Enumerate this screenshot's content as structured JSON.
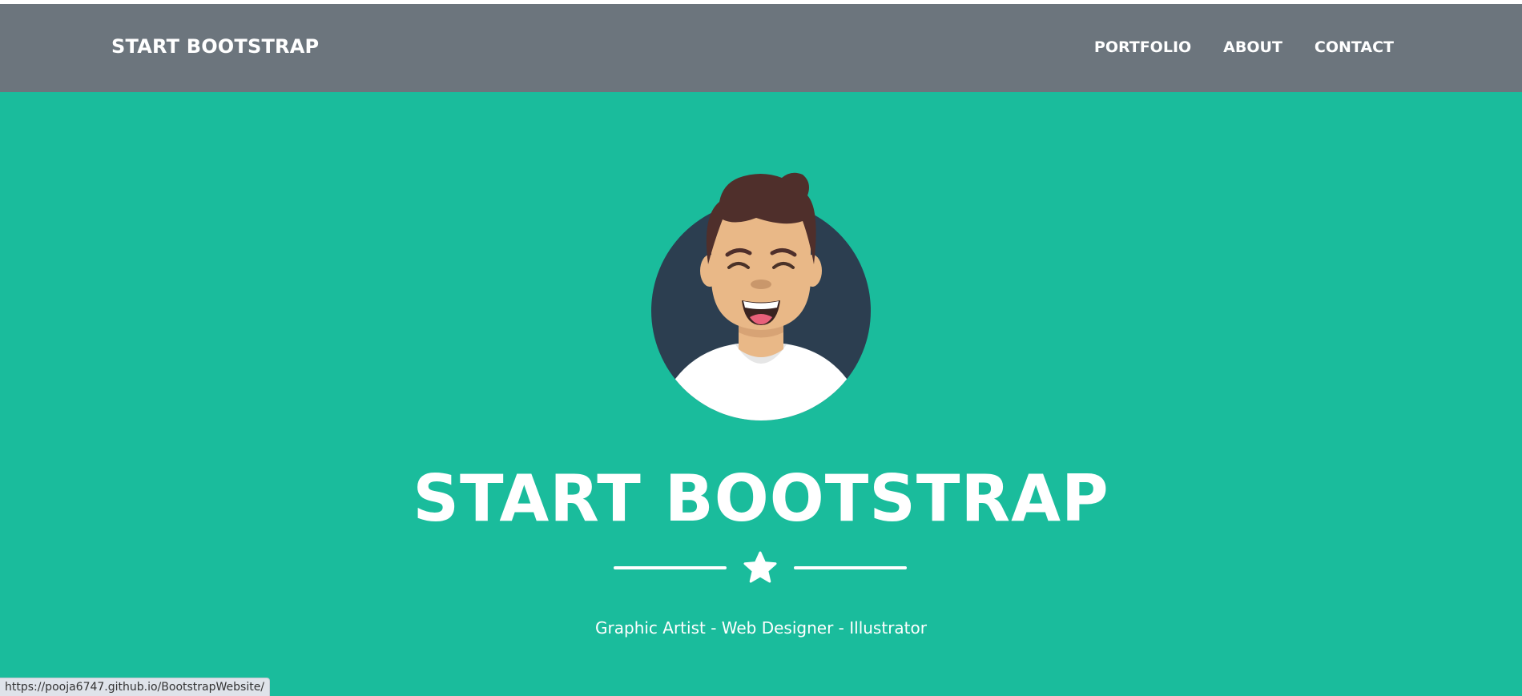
{
  "navbar": {
    "brand": "START BOOTSTRAP",
    "links": [
      {
        "label": "PORTFOLIO"
      },
      {
        "label": "ABOUT"
      },
      {
        "label": "CONTACT"
      }
    ],
    "background": "#6c757d"
  },
  "masthead": {
    "title": "START BOOTSTRAP",
    "subtitle": "Graphic Artist - Web Designer - Illustrator",
    "divider_icon": "star-icon",
    "avatar_icon": "avatar-illustration",
    "background": "#1abc9c"
  },
  "status_bar": {
    "url": "https://pooja6747.github.io/BootstrapWebsite/"
  },
  "colors": {
    "primary": "#1abc9c",
    "nav": "#6c757d",
    "text": "#ffffff",
    "avatar_bg": "#2c3e50",
    "hair": "#4f2f2b",
    "skin": "#e9b887"
  }
}
